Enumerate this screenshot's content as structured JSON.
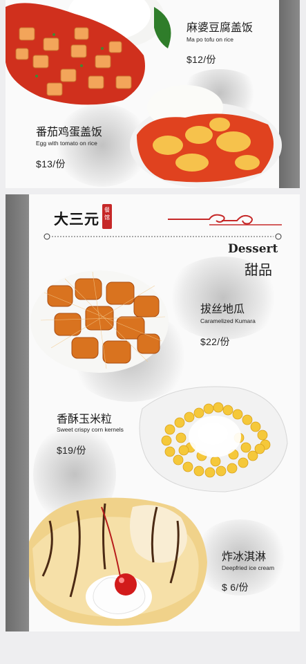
{
  "brand": {
    "name": "大三元",
    "seal_text": "餐馆"
  },
  "top_page": {
    "items": [
      {
        "name_zh": "麻婆豆腐盖饭",
        "name_en": "Ma po tofu on rice",
        "price": "$12/份"
      },
      {
        "name_zh": "番茄鸡蛋盖饭",
        "name_en": "Egg with tomato on rice",
        "price": "$13/份"
      }
    ]
  },
  "bottom_page": {
    "section_title_en": "Dessert",
    "section_title_zh": "甜品",
    "items": [
      {
        "name_zh": "拔丝地瓜",
        "name_en": "Caramelized Kumara",
        "price": "$22/份"
      },
      {
        "name_zh": "香酥玉米粒",
        "name_en": "Sweet crispy corn kernels",
        "price": "$19/份"
      },
      {
        "name_zh": "炸冰淇淋",
        "name_en": "Deepfried ice cream",
        "price": "$ 6/份"
      }
    ]
  },
  "colors": {
    "accent_red": "#c62828",
    "side_strip": "#7a7a7a",
    "page_background": "#fafafa"
  }
}
